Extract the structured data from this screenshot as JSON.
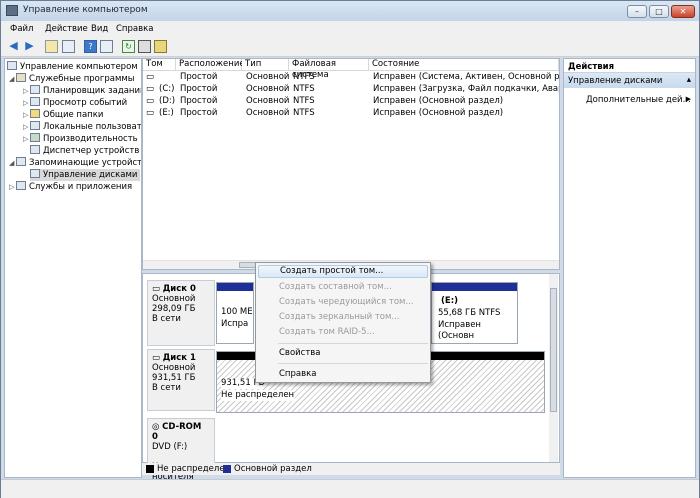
{
  "window": {
    "title": "Управление компьютером"
  },
  "menu": [
    "Файл",
    "Действие",
    "Вид",
    "Справка"
  ],
  "tree": {
    "root": "Управление компьютером (л",
    "system_tools": "Служебные программы",
    "task_scheduler": "Планировщик заданий",
    "event_viewer": "Просмотр событий",
    "shared_folders": "Общие папки",
    "local_users": "Локальные пользовате",
    "performance": "Производительность",
    "device_manager": "Диспетчер устройств",
    "storage": "Запоминающие устройст",
    "disk_management": "Управление дисками",
    "services": "Службы и приложения"
  },
  "volumes": {
    "columns": [
      "Том",
      "Расположение",
      "Тип",
      "Файловая система",
      "Состояние"
    ],
    "rows": [
      {
        "vol": "",
        "layout": "Простой",
        "type": "Основной",
        "fs": "NTFS",
        "status": "Исправен (Система, Активен, Основной раздел)"
      },
      {
        "vol": "(C:)",
        "layout": "Простой",
        "type": "Основной",
        "fs": "NTFS",
        "status": "Исправен (Загрузка, Файл подкачки, Аварийный"
      },
      {
        "vol": "(D:)",
        "layout": "Простой",
        "type": "Основной",
        "fs": "NTFS",
        "status": "Исправен (Основной раздел)"
      },
      {
        "vol": "(E:)",
        "layout": "Простой",
        "type": "Основной",
        "fs": "NTFS",
        "status": "Исправен (Основной раздел)"
      }
    ]
  },
  "disks": {
    "disk0": {
      "name": "Диск 0",
      "kind": "Основной",
      "size": "298,09 ГБ",
      "state": "В сети",
      "p1_line1": "100 МЕ",
      "p1_line2": "Испра",
      "e_name": "(E:)",
      "e_size": "55,68 ГБ NTFS",
      "e_state": "Исправен (Основн"
    },
    "disk1": {
      "name": "Диск 1",
      "kind": "Основной",
      "size": "931,51 ГБ",
      "state": "В сети",
      "un_size": "931,51 ГБ",
      "un_state": "Не распределен"
    },
    "cdrom": {
      "name": "CD-ROM 0",
      "kind": "DVD (F:)",
      "state": "Нет носителя"
    }
  },
  "legend": {
    "unallocated": "Не распределен",
    "primary": "Основной раздел"
  },
  "context_menu": {
    "new_simple": "Создать простой том...",
    "new_spanned": "Создать составной том...",
    "new_striped": "Создать чередующийся том...",
    "new_mirrored": "Создать зеркальный том...",
    "new_raid5": "Создать том RAID-5...",
    "properties": "Свойства",
    "help": "Справка"
  },
  "actions": {
    "title": "Действия",
    "section": "Управление дисками",
    "more": "Дополнительные дей..."
  },
  "colors": {
    "primary_partition": "#1f2f96",
    "unallocated": "#000000",
    "accent": "#3a6ea5"
  }
}
